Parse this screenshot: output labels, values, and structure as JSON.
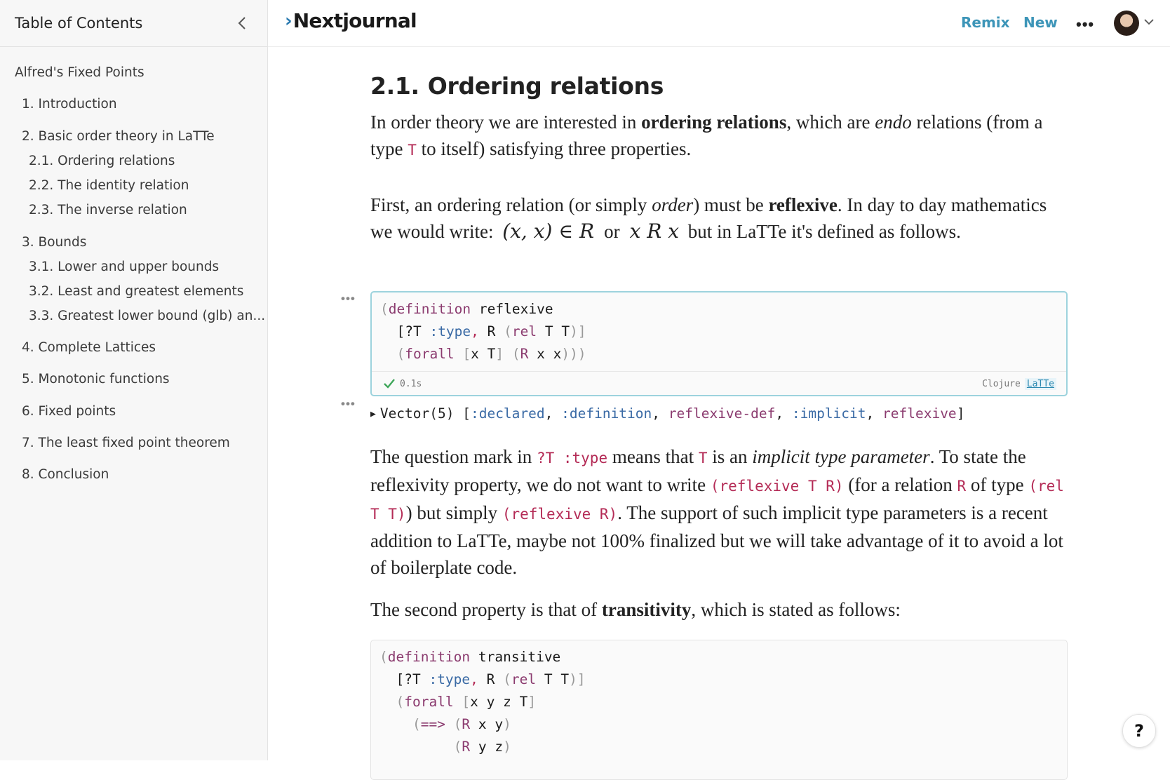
{
  "sidebar": {
    "title": "Table of Contents",
    "items": [
      "Alfred's Fixed Points",
      "1. Introduction",
      "2. Basic order theory in LaTTe",
      "2.1. Ordering relations",
      "2.2. The identity relation",
      "2.3. The inverse relation",
      "3. Bounds",
      "3.1. Lower and upper bounds",
      "3.2. Least and greatest elements",
      "3.3. Greatest lower bound (glb) an...",
      "4. Complete Lattices",
      "5. Monotonic functions",
      "6. Fixed points",
      "7. The least fixed point theorem",
      "8. Conclusion"
    ]
  },
  "header": {
    "logo": "Nextjournal",
    "remix": "Remix",
    "new": "New",
    "more": "•••"
  },
  "article": {
    "section_num": "2.1.",
    "section_title": "Ordering relations",
    "p1": {
      "a": "In order theory we are interested in ",
      "b": "ordering relations",
      "c": ", which are ",
      "d": "endo",
      "e": " relations (from a type ",
      "code": "T",
      "f": " to itself) satisfying three properties."
    },
    "p2": {
      "a": "First, an ordering relation (or simply ",
      "b": "order",
      "c": ") must be ",
      "d": "reflexive",
      "e": ". In day to day mathematics we would write: ",
      "math1": "(x, x) ∈ R",
      "or": "or",
      "math2": "x R x",
      "f": " but in LaTTe it's defined as follows."
    },
    "cell1": {
      "line1": {
        "a": "(",
        "b": "definition",
        "c": " reflexive"
      },
      "line2": {
        "a": "  [?T ",
        "b": ":type",
        "c": ",",
        "d": " R ",
        "e": "(",
        "f": "rel",
        "g": " T T",
        "h": ")]"
      },
      "line3": {
        "a": "  (",
        "b": "forall",
        "c": " [",
        "d": "x T",
        "e": "] (",
        "f": "R",
        "g": " x x",
        "h": ")))"
      },
      "time": "0.1s",
      "lang": "Clojure",
      "lib": "LaTTe"
    },
    "result": {
      "a": "Vector(5) [",
      "b": ":declared",
      "c": ", ",
      "d": ":definition",
      "e": ", ",
      "f": "reflexive-def",
      "g": ", ",
      "h": ":implicit",
      "i": ", ",
      "j": "reflexive",
      "k": "]"
    },
    "p3": {
      "a": "The question mark in ",
      "c1": "?T :type",
      "b": " means that ",
      "c2": "T",
      "c": " is an ",
      "d": "implicit type parameter",
      "e": ". To state the reflexivity property, we do not want to write ",
      "c3": "(reflexive T R)",
      "f": " (for a relation ",
      "c4": "R",
      "g": " of type ",
      "c5": "(rel T T)",
      "h": ") but simply ",
      "c6": "(reflexive R)",
      "i": ". The support of such implicit type parameters is a recent addition to LaTTe, maybe not 100% finalized but we will take advantage of it to avoid a lot of boilerplate code."
    },
    "p4": {
      "a": "The second property is that of ",
      "b": "transitivity",
      "c": ", which is stated as follows:"
    },
    "cell2": {
      "line1": {
        "a": "(",
        "b": "definition",
        "c": " transitive"
      },
      "line2": {
        "a": "  [?T ",
        "b": ":type",
        "c": ",",
        "d": " R ",
        "e": "(",
        "f": "rel",
        "g": " T T",
        "h": ")]"
      },
      "line3": {
        "a": "  (",
        "b": "forall",
        "c": " [",
        "d": "x y z T",
        "e": "]"
      },
      "line4": {
        "a": "    (",
        "b": "==>",
        "c": " (",
        "d": "R",
        "e": " x y",
        "f": ")"
      },
      "line5": {
        "a": "         (",
        "b": "R",
        "c": " y z",
        "d": ")"
      }
    }
  },
  "cell_menu": "•••",
  "help": "?"
}
